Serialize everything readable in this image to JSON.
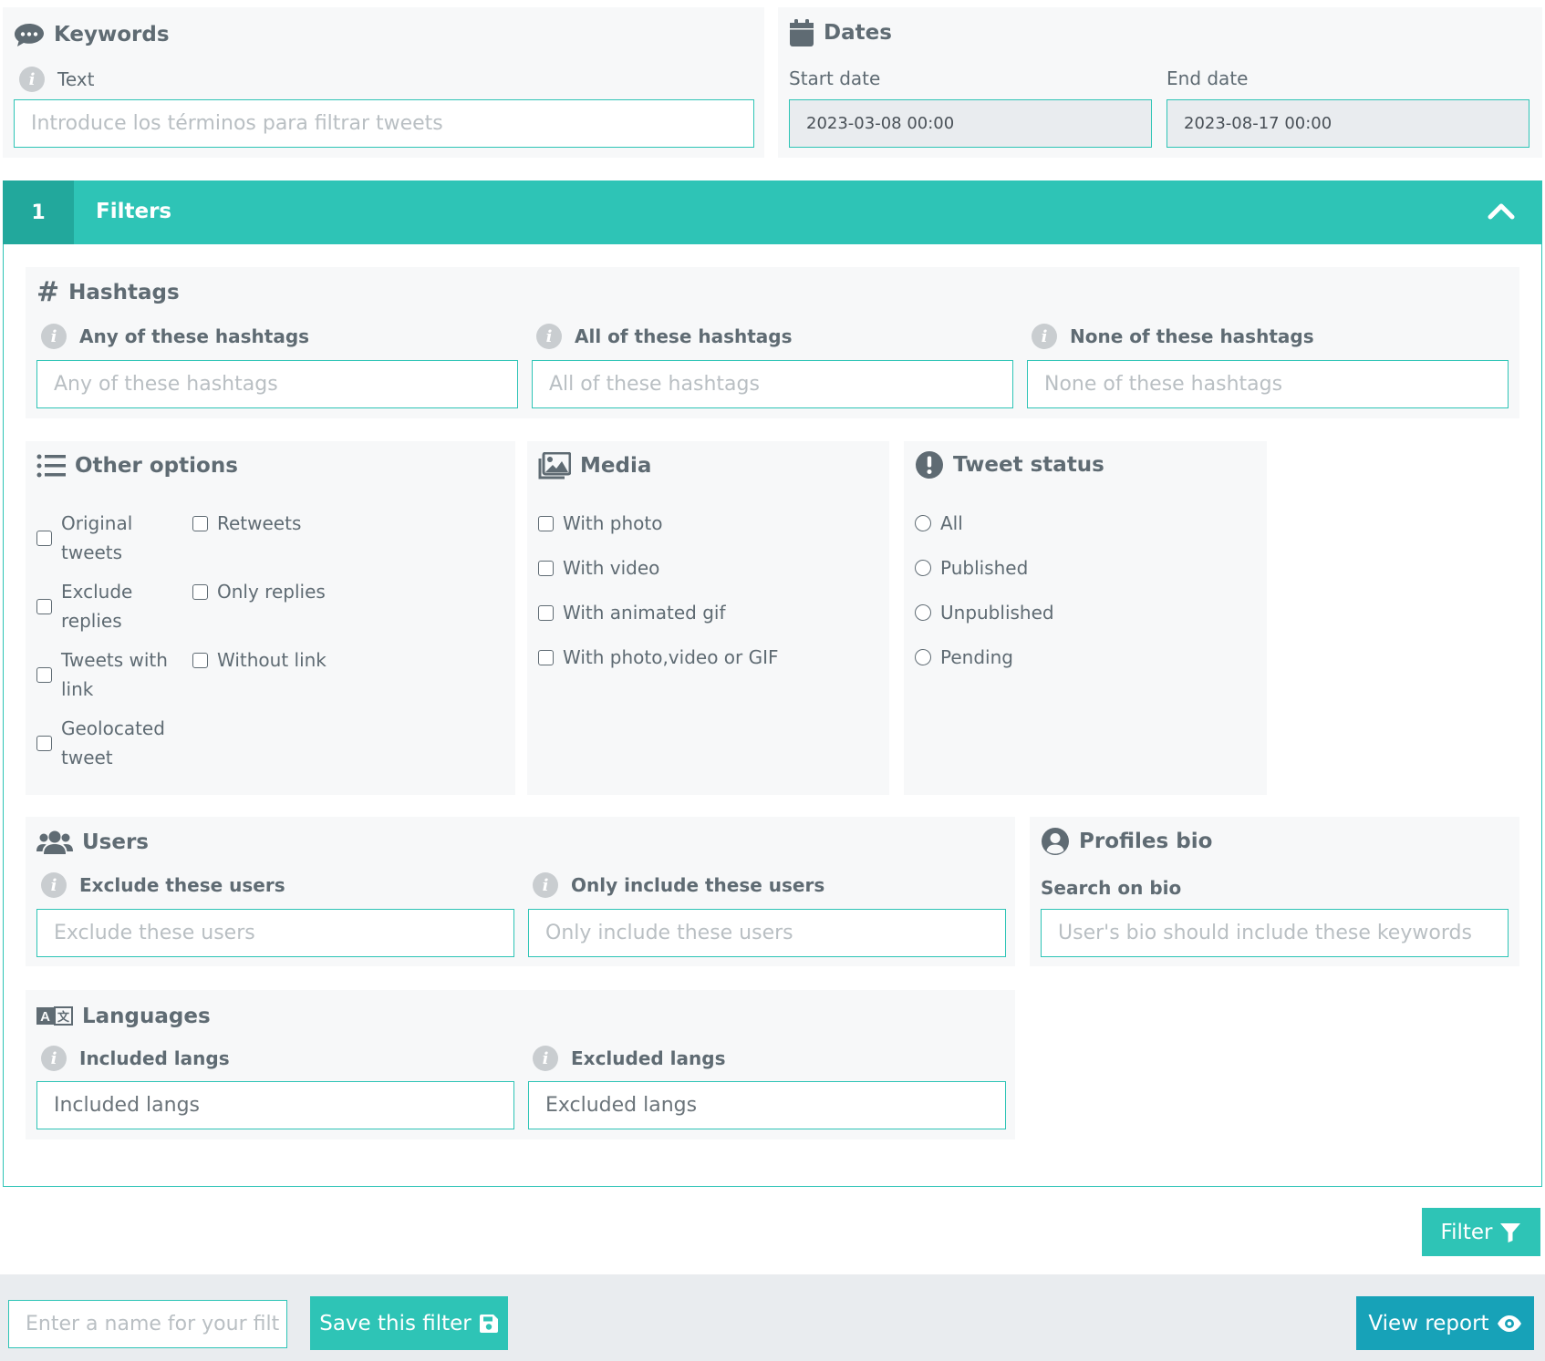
{
  "keywords": {
    "title": "Keywords",
    "text_label": "Text",
    "text_placeholder": "Introduce los términos para filtrar tweets"
  },
  "dates": {
    "title": "Dates",
    "start_label": "Start date",
    "start_value": "2023-03-08 00:00",
    "end_label": "End date",
    "end_value": "2023-08-17 00:00"
  },
  "filters_bar": {
    "step": "1",
    "title": "Filters"
  },
  "hashtags": {
    "title": "Hashtags",
    "any_label": "Any of these hashtags",
    "any_placeholder": "Any of these hashtags",
    "all_label": "All of these hashtags",
    "all_placeholder": "All of these hashtags",
    "none_label": "None of these hashtags",
    "none_placeholder": "None of these hashtags"
  },
  "other_options": {
    "title": "Other options",
    "original_tweets": [
      "Original",
      "tweets"
    ],
    "retweets": "Retweets",
    "exclude_replies": [
      "Exclude",
      "replies"
    ],
    "only_replies": "Only replies",
    "tweets_with_link": [
      "Tweets with",
      "link"
    ],
    "without_link": "Without link",
    "geolocated": [
      "Geolocated",
      "tweet"
    ]
  },
  "media": {
    "title": "Media",
    "items": [
      "With photo",
      "With video",
      "With animated gif",
      "With photo,video or GIF"
    ]
  },
  "tweet_status": {
    "title": "Tweet status",
    "items": [
      "All",
      "Published",
      "Unpublished",
      "Pending"
    ]
  },
  "users": {
    "title": "Users",
    "exclude_label": "Exclude these users",
    "exclude_placeholder": "Exclude these users",
    "include_label": "Only include these users",
    "include_placeholder": "Only include these users"
  },
  "profiles_bio": {
    "title": "Profiles bio",
    "search_label": "Search on bio",
    "search_placeholder": "User's bio should include these keywords"
  },
  "languages": {
    "title": "Languages",
    "included_label": "Included langs",
    "included_placeholder": "Included langs",
    "excluded_label": "Excluded langs",
    "excluded_placeholder": "Excluded langs"
  },
  "filter_button": "Filter",
  "footer": {
    "name_placeholder": "Enter a name for your filt",
    "save_button": "Save this filter",
    "view_report_button": "View report"
  },
  "colors": {
    "accent": "#2ec4b6",
    "accent_dark": "#22a89c",
    "report_button": "#17a2b8",
    "text": "#5f6b73"
  }
}
